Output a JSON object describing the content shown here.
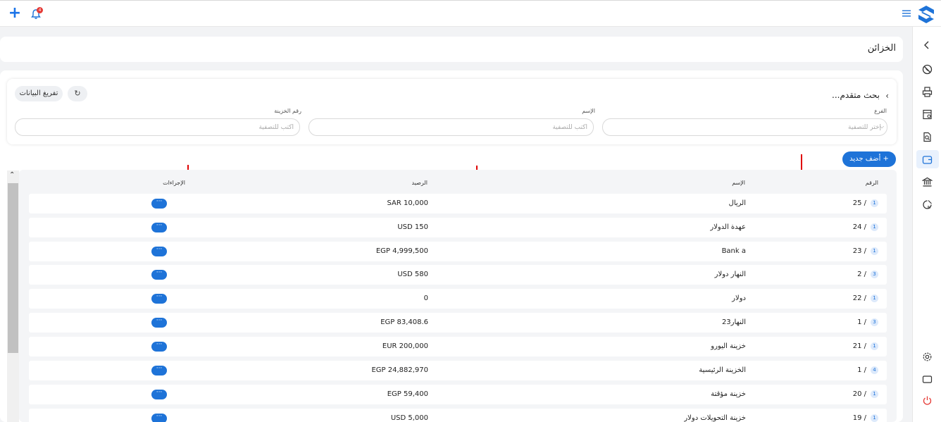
{
  "topbar": {
    "notification_count": "4"
  },
  "page": {
    "title": "الخزائن"
  },
  "search": {
    "title": "بحث متقدم...",
    "reset_icon": "↻",
    "clear_label": "تفريغ البيانات",
    "fields": {
      "branch": {
        "label": "الفرع",
        "placeholder": "إختر للتصفية"
      },
      "name": {
        "label": "الإسم",
        "placeholder": "أكتب للتصفية"
      },
      "treasury_number": {
        "label": "رقم الخزينة",
        "placeholder": "أكتب للتصفية"
      }
    }
  },
  "add_button": {
    "label": "+ أضف جديد"
  },
  "table": {
    "headers": {
      "number": "الرقم",
      "name": "الإسم",
      "balance": "الرصيد",
      "actions": "الإجراءات"
    },
    "action_label": "···",
    "rows": [
      {
        "badge": "1",
        "number": "25 /",
        "name": "الريال",
        "balance": "SAR 10,000"
      },
      {
        "badge": "1",
        "number": "24 /",
        "name": "عهدة الدولار",
        "balance": "USD 150"
      },
      {
        "badge": "1",
        "number": "23 /",
        "name": "Bank a",
        "balance": "EGP 4,999,500"
      },
      {
        "badge": "3",
        "number": "2 /",
        "name": "النهار دولار",
        "balance": "USD 580"
      },
      {
        "badge": "1",
        "number": "22 /",
        "name": "دولار",
        "balance": "0"
      },
      {
        "badge": "3",
        "number": "1 /",
        "name": "النهار23",
        "balance": "EGP 83,408.6"
      },
      {
        "badge": "1",
        "number": "21 /",
        "name": "خزينة اليورو",
        "balance": "EUR 200,000"
      },
      {
        "badge": "4",
        "number": "1 /",
        "name": "الخزينة الرئيسية",
        "balance": "EGP 24,882,970"
      },
      {
        "badge": "1",
        "number": "20 /",
        "name": "خزينة مؤقتة",
        "balance": "EGP 59,400"
      },
      {
        "badge": "1",
        "number": "19 /",
        "name": "خزينة التحويلات دولار",
        "balance": "USD 5,000"
      }
    ]
  },
  "sidebar": {
    "icons": [
      "chevron-left-icon",
      "no-entry-icon",
      "printer-icon",
      "receipt-icon",
      "document-search-icon",
      "wallet-icon",
      "bank-icon",
      "chart-icon",
      "gear-icon",
      "monitor-icon",
      "power-icon"
    ]
  },
  "colors": {
    "accent": "#1e73d8",
    "arrow": "#e00000",
    "power": "#e53935"
  }
}
